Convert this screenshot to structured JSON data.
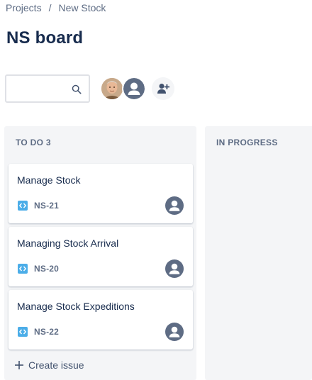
{
  "breadcrumb": {
    "projects": "Projects",
    "separator": "/",
    "project": "New Stock"
  },
  "page_title": "NS board",
  "search": {
    "value": "",
    "placeholder": ""
  },
  "columns": [
    {
      "title": "TO DO 3",
      "cards": [
        {
          "summary": "Manage Stock",
          "key": "NS-21",
          "type_icon": "subtask-code-icon"
        },
        {
          "summary": "Managing Stock Arrival",
          "key": "NS-20",
          "type_icon": "subtask-code-icon"
        },
        {
          "summary": "Manage Stock Expeditions",
          "key": "NS-22",
          "type_icon": "subtask-code-icon"
        }
      ],
      "create_label": "Create issue"
    },
    {
      "title": "IN PROGRESS",
      "cards": []
    }
  ],
  "colors": {
    "accent_blue": "#4bade8",
    "text_primary": "#172b4d",
    "text_secondary": "#5e6c84",
    "column_bg": "#f4f5f7",
    "avatar_gray": "#5e6c84"
  }
}
